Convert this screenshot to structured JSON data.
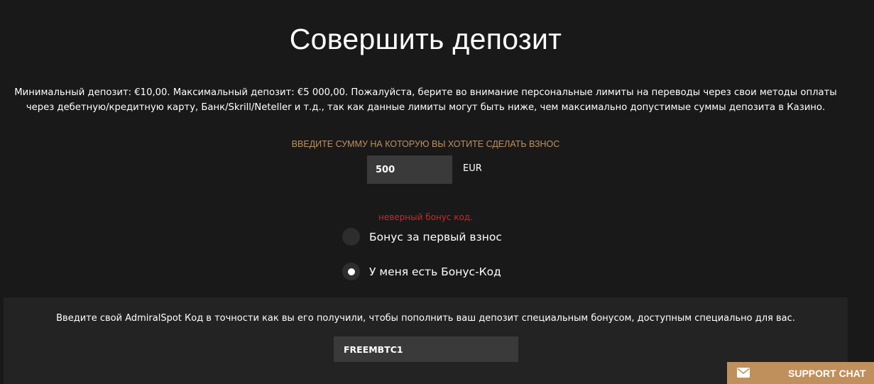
{
  "page": {
    "title": "Совершить депозит",
    "info_line1": "Минимальный депозит: €10,00. Максимальный депозит: €5 000,00. Пожалуйста, берите во внимание персональные лимиты на переводы через свои методы оплаты",
    "info_line2": "через дебетную/кредитную карту, Банк/Skrill/Neteller и т.д., так как данные лимиты могут быть ниже, чем максимально допустимые суммы депозита в Казино."
  },
  "amount": {
    "label": "Введите сумму на которую вы хотите сделать взнос",
    "value": "500",
    "currency": "EUR"
  },
  "error": {
    "text": "неверный бонус код."
  },
  "bonus_options": [
    {
      "label": "Бонус за первый взнос",
      "selected": false
    },
    {
      "label": "У меня есть Бонус-Код",
      "selected": true
    }
  ],
  "bonus_code": {
    "instruction": "Введите свой AdmiralSpot Код в точности как вы его получили, чтобы пополнить ваш депозит специальным бонусом, доступным специально для вас.",
    "value": "FREEMBTC1"
  },
  "support": {
    "label": "SUPPORT CHAT",
    "icon": "envelope-icon"
  },
  "colors": {
    "background": "#191919",
    "accent": "#c0905c",
    "error": "#d0262b",
    "input_bg": "#3a3a3a",
    "panel_bg": "#232323"
  }
}
